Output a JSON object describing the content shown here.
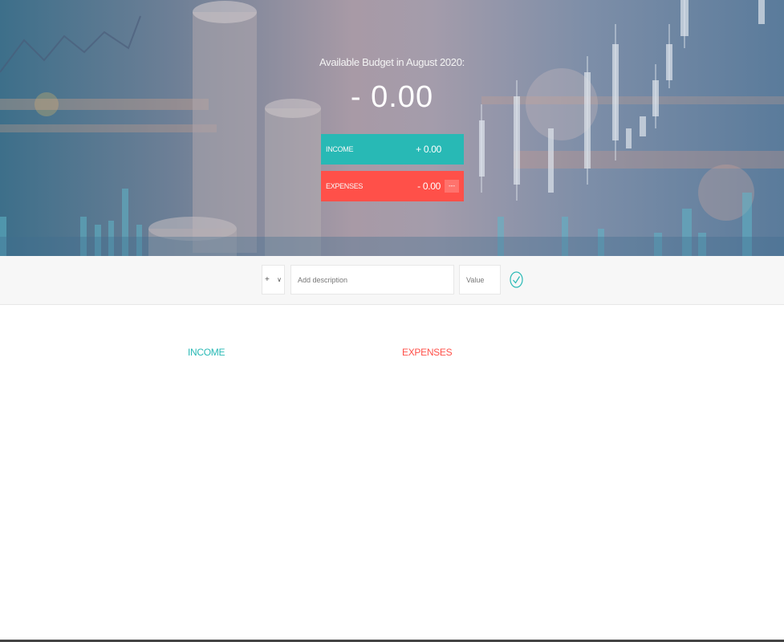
{
  "budget": {
    "title": "Available Budget in August 2020:",
    "value": "- 0.00"
  },
  "summary": {
    "income": {
      "label": "INCOME",
      "value": "+ 0.00",
      "color": "#28b9b5"
    },
    "expenses": {
      "label": "EXPENSES",
      "value": "- 0.00",
      "percentage": "---",
      "color": "#ff5049"
    }
  },
  "add": {
    "type_value": "+",
    "type_options": [
      "+",
      "-"
    ],
    "description_placeholder": "Add description",
    "value_placeholder": "Value",
    "submit_icon": "check-circle-icon"
  },
  "lists": {
    "income_title": "INCOME",
    "expenses_title": "EXPENSES"
  }
}
